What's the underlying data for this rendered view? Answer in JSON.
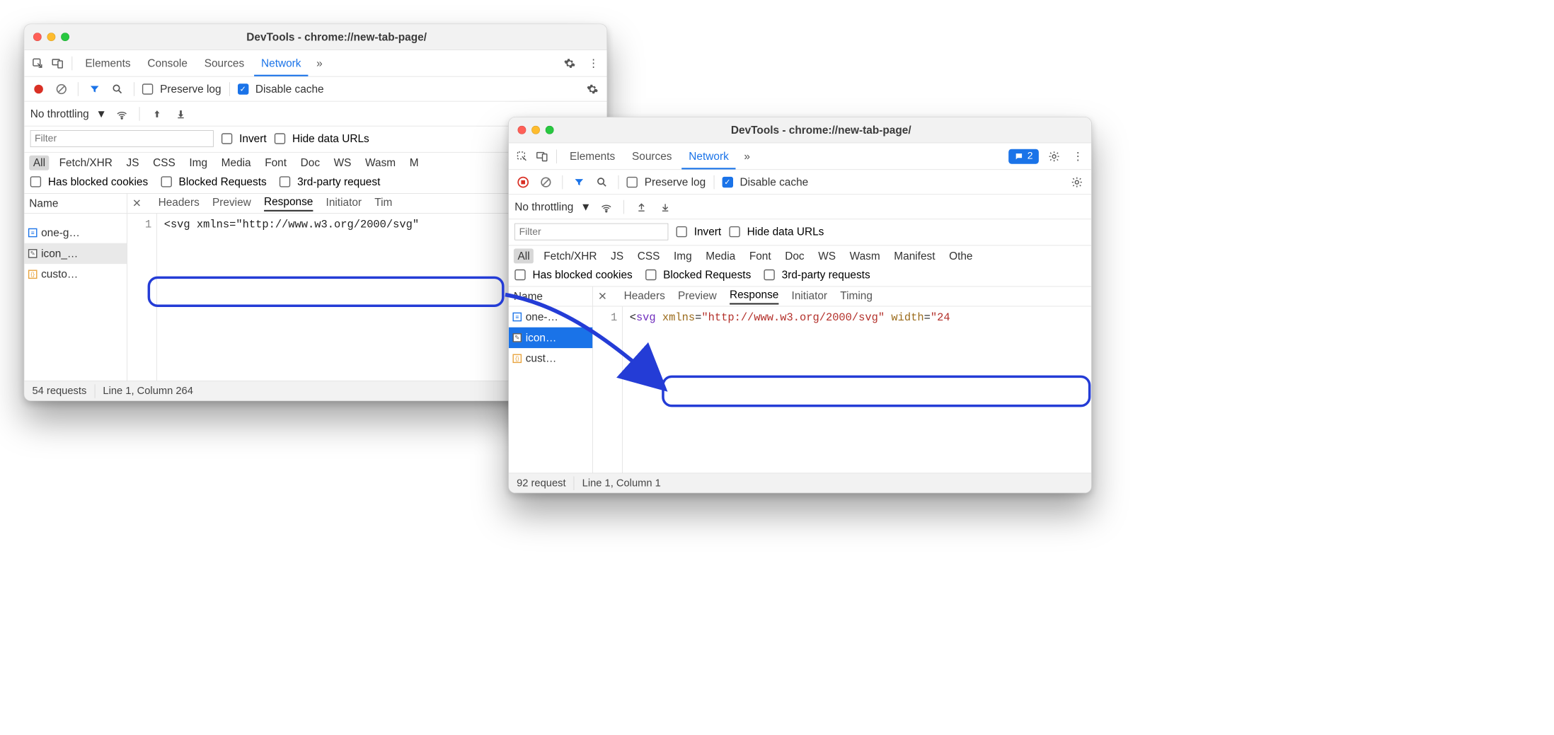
{
  "window1": {
    "title": "DevTools - chrome://new-tab-page/",
    "tabs": {
      "elements": "Elements",
      "console": "Console",
      "sources": "Sources",
      "network": "Network"
    },
    "toolbar": {
      "preserve_log": "Preserve log",
      "disable_cache": "Disable cache"
    },
    "throttling": "No throttling",
    "filter_placeholder": "Filter",
    "invert_label": "Invert",
    "hide_urls_label": "Hide data URLs",
    "types": [
      "All",
      "Fetch/XHR",
      "JS",
      "CSS",
      "Img",
      "Media",
      "Font",
      "Doc",
      "WS",
      "Wasm",
      "M"
    ],
    "checks": {
      "blocked_cookies": "Has blocked cookies",
      "blocked_requests": "Blocked Requests",
      "third_party": "3rd-party request"
    },
    "name_header": "Name",
    "files": [
      "one-g…",
      "icon_…",
      "custo…"
    ],
    "detail_tabs": {
      "headers": "Headers",
      "preview": "Preview",
      "response": "Response",
      "initiator": "Initiator",
      "timing": "Tim"
    },
    "code_line_no": "1",
    "code_tag": "svg",
    "code_attr": "xmlns",
    "code_val": "\"http://www.w3.org/2000/svg\"",
    "status": {
      "requests": "54 requests",
      "position": "Line 1, Column 264"
    }
  },
  "window2": {
    "title": "DevTools - chrome://new-tab-page/",
    "tabs": {
      "elements": "Elements",
      "sources": "Sources",
      "network": "Network"
    },
    "issues_count": "2",
    "toolbar": {
      "preserve_log": "Preserve log",
      "disable_cache": "Disable cache"
    },
    "throttling": "No throttling",
    "filter_placeholder": "Filter",
    "invert_label": "Invert",
    "hide_urls_label": "Hide data URLs",
    "types": [
      "All",
      "Fetch/XHR",
      "JS",
      "CSS",
      "Img",
      "Media",
      "Font",
      "Doc",
      "WS",
      "Wasm",
      "Manifest",
      "Othe"
    ],
    "checks": {
      "blocked_cookies": "Has blocked cookies",
      "blocked_requests": "Blocked Requests",
      "third_party": "3rd-party requests"
    },
    "name_header": "Name",
    "files": [
      "one-…",
      "icon…",
      "cust…"
    ],
    "detail_tabs": {
      "headers": "Headers",
      "preview": "Preview",
      "response": "Response",
      "initiator": "Initiator",
      "timing": "Timing"
    },
    "code_line_no": "1",
    "code_tag": "svg",
    "code_attr1": "xmlns",
    "code_val1": "\"http://www.w3.org/2000/svg\"",
    "code_attr2": "width",
    "code_val2": "\"24",
    "status": {
      "requests": "92 request",
      "position": "Line 1, Column 1"
    }
  }
}
